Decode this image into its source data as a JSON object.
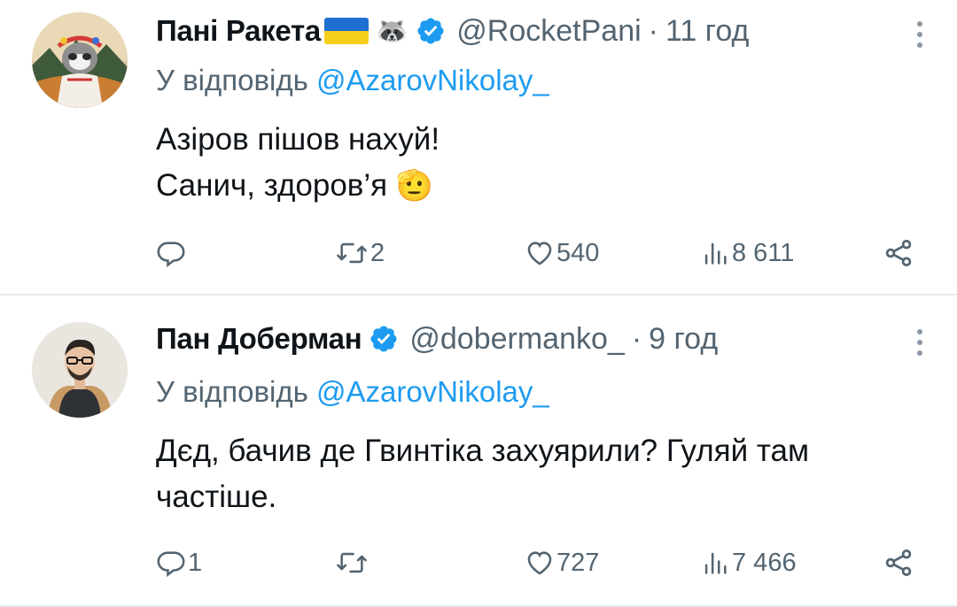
{
  "tweets": [
    {
      "author_name": "Пані Ракета",
      "author_emoji": "🦝",
      "handle": "@RocketPani",
      "separator": "·",
      "time": "11 год",
      "reply_prefix": "У відповідь",
      "reply_to": "@AzarovNikolay_",
      "text_line1": "Азіров пішов нахуй!",
      "text_line2": "Санич, здоров’я",
      "text_emoji": "🫡",
      "replies": "",
      "retweets": "2",
      "likes": "540",
      "views": "8 611"
    },
    {
      "author_name": "Пан Доберман",
      "handle": "@dobermanko_",
      "separator": "·",
      "time": "9 год",
      "reply_prefix": "У відповідь",
      "reply_to": "@AzarovNikolay_",
      "text_line1": "Дєд, бачив де Гвинтіка захуярили? Гуляй там",
      "text_line2": "частіше.",
      "replies": "1",
      "retweets": "",
      "likes": "727",
      "views": "7 466"
    }
  ],
  "colors": {
    "verified": "#1d9bf0",
    "mention": "#1d9bf0",
    "secondary_text": "#536471",
    "flag_blue": "#1f6fd1",
    "flag_yellow": "#f6cf1b"
  },
  "icons": [
    "verified-badge-icon",
    "more-options-icon",
    "reply-icon",
    "retweet-icon",
    "like-icon",
    "views-icon",
    "share-icon",
    "ukraine-flag-icon"
  ]
}
